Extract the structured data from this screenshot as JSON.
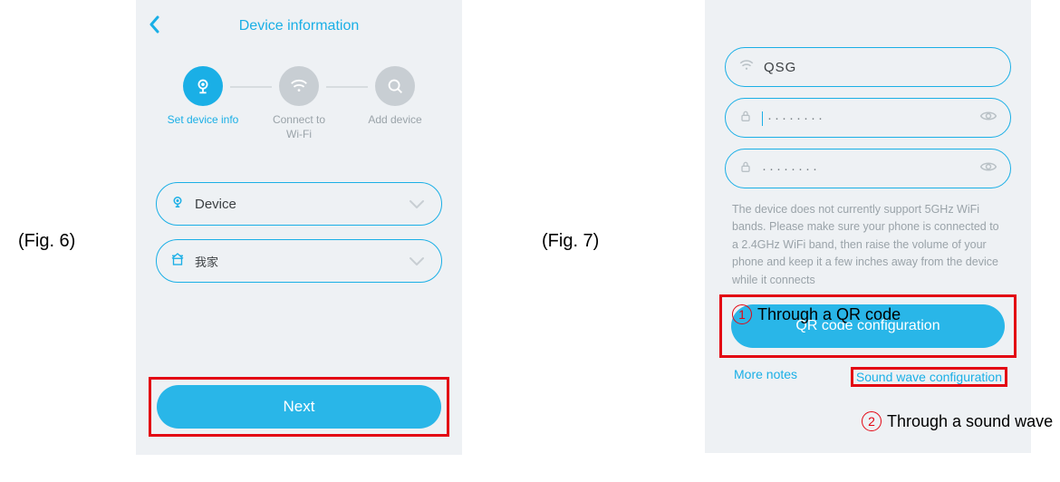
{
  "figures": {
    "fig6": "(Fig. 6)",
    "fig7": "(Fig. 7)"
  },
  "screen1": {
    "title": "Device information",
    "steps": {
      "s1": "Set device info",
      "s2": "Connect to\nWi-Fi",
      "s3": "Add device"
    },
    "deviceSelect": "Device",
    "locationSelect": "我家",
    "next": "Next"
  },
  "screen2": {
    "ssid": "QSG",
    "pwd1": "········",
    "pwd2": "········",
    "note": "The device does not currently support 5GHz WiFi bands. Please make sure your phone is connected to a 2.4GHz WiFi band, then raise the volume of your phone and keep it a few inches away from the device while it connects",
    "qrButton": "QR code configuration",
    "moreNotes": "More notes",
    "soundWave": "Sound wave configuration"
  },
  "annotations": {
    "a1_num": "1",
    "a1_text": "Through a QR code",
    "a2_num": "2",
    "a2_text": "Through a sound wave"
  }
}
